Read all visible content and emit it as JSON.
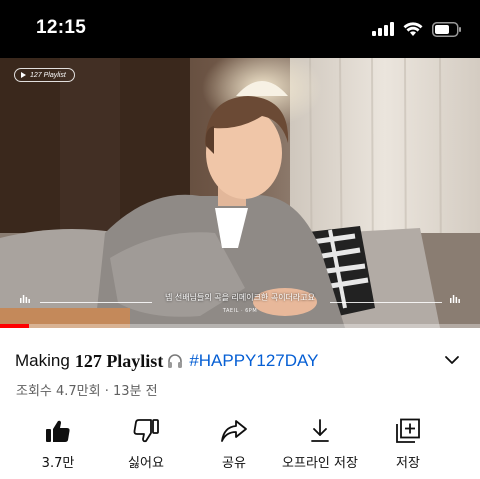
{
  "status_bar": {
    "time": "12:15",
    "icons": [
      "signal-icon",
      "wifi-icon",
      "battery-icon"
    ]
  },
  "player": {
    "badge_label": "127 Playlist",
    "subtitle": "넵 선배님들의 곡을 리메이크한 곡이더라고요",
    "subtitle_credit": "TAEIL · 6PM",
    "progress_fraction": 0.06,
    "progress_color": "#ff0000"
  },
  "video": {
    "title_prefix": "Making",
    "title_main": "127 Playlist",
    "title_icon": "headphone-icon",
    "hashtag": "#HAPPY127DAY",
    "hashtag_color": "#065fd4",
    "meta": "조회수 4.7만회 · 13분 전"
  },
  "actions": [
    {
      "icon": "thumbs-up-icon",
      "label": "3.7만"
    },
    {
      "icon": "thumbs-down-icon",
      "label": "싫어요"
    },
    {
      "icon": "share-icon",
      "label": "공유"
    },
    {
      "icon": "download-icon",
      "label": "오프라인 저장"
    },
    {
      "icon": "save-to-playlist-icon",
      "label": "저장"
    }
  ]
}
